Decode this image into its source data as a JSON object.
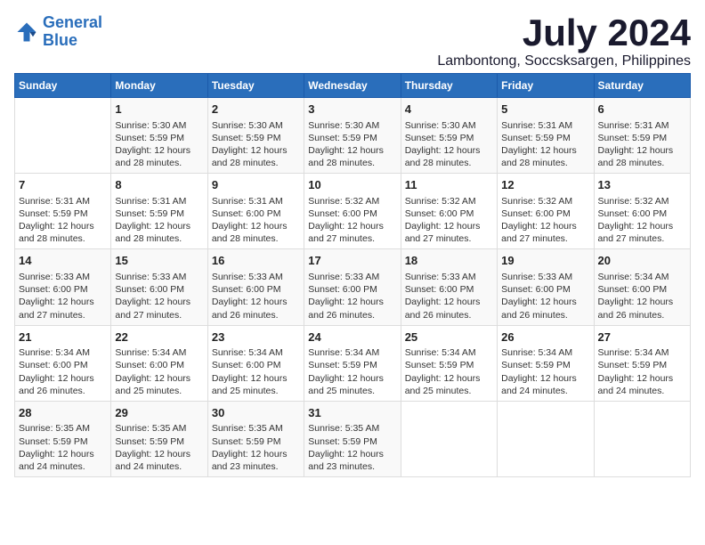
{
  "header": {
    "logo_line1": "General",
    "logo_line2": "Blue",
    "title": "July 2024",
    "subtitle": "Lambontong, Soccsksargen, Philippines"
  },
  "calendar": {
    "days_of_week": [
      "Sunday",
      "Monday",
      "Tuesday",
      "Wednesday",
      "Thursday",
      "Friday",
      "Saturday"
    ],
    "weeks": [
      [
        {
          "day": "",
          "text": ""
        },
        {
          "day": "1",
          "text": "Sunrise: 5:30 AM\nSunset: 5:59 PM\nDaylight: 12 hours\nand 28 minutes."
        },
        {
          "day": "2",
          "text": "Sunrise: 5:30 AM\nSunset: 5:59 PM\nDaylight: 12 hours\nand 28 minutes."
        },
        {
          "day": "3",
          "text": "Sunrise: 5:30 AM\nSunset: 5:59 PM\nDaylight: 12 hours\nand 28 minutes."
        },
        {
          "day": "4",
          "text": "Sunrise: 5:30 AM\nSunset: 5:59 PM\nDaylight: 12 hours\nand 28 minutes."
        },
        {
          "day": "5",
          "text": "Sunrise: 5:31 AM\nSunset: 5:59 PM\nDaylight: 12 hours\nand 28 minutes."
        },
        {
          "day": "6",
          "text": "Sunrise: 5:31 AM\nSunset: 5:59 PM\nDaylight: 12 hours\nand 28 minutes."
        }
      ],
      [
        {
          "day": "7",
          "text": "Sunrise: 5:31 AM\nSunset: 5:59 PM\nDaylight: 12 hours\nand 28 minutes."
        },
        {
          "day": "8",
          "text": "Sunrise: 5:31 AM\nSunset: 5:59 PM\nDaylight: 12 hours\nand 28 minutes."
        },
        {
          "day": "9",
          "text": "Sunrise: 5:31 AM\nSunset: 6:00 PM\nDaylight: 12 hours\nand 28 minutes."
        },
        {
          "day": "10",
          "text": "Sunrise: 5:32 AM\nSunset: 6:00 PM\nDaylight: 12 hours\nand 27 minutes."
        },
        {
          "day": "11",
          "text": "Sunrise: 5:32 AM\nSunset: 6:00 PM\nDaylight: 12 hours\nand 27 minutes."
        },
        {
          "day": "12",
          "text": "Sunrise: 5:32 AM\nSunset: 6:00 PM\nDaylight: 12 hours\nand 27 minutes."
        },
        {
          "day": "13",
          "text": "Sunrise: 5:32 AM\nSunset: 6:00 PM\nDaylight: 12 hours\nand 27 minutes."
        }
      ],
      [
        {
          "day": "14",
          "text": "Sunrise: 5:33 AM\nSunset: 6:00 PM\nDaylight: 12 hours\nand 27 minutes."
        },
        {
          "day": "15",
          "text": "Sunrise: 5:33 AM\nSunset: 6:00 PM\nDaylight: 12 hours\nand 27 minutes."
        },
        {
          "day": "16",
          "text": "Sunrise: 5:33 AM\nSunset: 6:00 PM\nDaylight: 12 hours\nand 26 minutes."
        },
        {
          "day": "17",
          "text": "Sunrise: 5:33 AM\nSunset: 6:00 PM\nDaylight: 12 hours\nand 26 minutes."
        },
        {
          "day": "18",
          "text": "Sunrise: 5:33 AM\nSunset: 6:00 PM\nDaylight: 12 hours\nand 26 minutes."
        },
        {
          "day": "19",
          "text": "Sunrise: 5:33 AM\nSunset: 6:00 PM\nDaylight: 12 hours\nand 26 minutes."
        },
        {
          "day": "20",
          "text": "Sunrise: 5:34 AM\nSunset: 6:00 PM\nDaylight: 12 hours\nand 26 minutes."
        }
      ],
      [
        {
          "day": "21",
          "text": "Sunrise: 5:34 AM\nSunset: 6:00 PM\nDaylight: 12 hours\nand 26 minutes."
        },
        {
          "day": "22",
          "text": "Sunrise: 5:34 AM\nSunset: 6:00 PM\nDaylight: 12 hours\nand 25 minutes."
        },
        {
          "day": "23",
          "text": "Sunrise: 5:34 AM\nSunset: 6:00 PM\nDaylight: 12 hours\nand 25 minutes."
        },
        {
          "day": "24",
          "text": "Sunrise: 5:34 AM\nSunset: 5:59 PM\nDaylight: 12 hours\nand 25 minutes."
        },
        {
          "day": "25",
          "text": "Sunrise: 5:34 AM\nSunset: 5:59 PM\nDaylight: 12 hours\nand 25 minutes."
        },
        {
          "day": "26",
          "text": "Sunrise: 5:34 AM\nSunset: 5:59 PM\nDaylight: 12 hours\nand 24 minutes."
        },
        {
          "day": "27",
          "text": "Sunrise: 5:34 AM\nSunset: 5:59 PM\nDaylight: 12 hours\nand 24 minutes."
        }
      ],
      [
        {
          "day": "28",
          "text": "Sunrise: 5:35 AM\nSunset: 5:59 PM\nDaylight: 12 hours\nand 24 minutes."
        },
        {
          "day": "29",
          "text": "Sunrise: 5:35 AM\nSunset: 5:59 PM\nDaylight: 12 hours\nand 24 minutes."
        },
        {
          "day": "30",
          "text": "Sunrise: 5:35 AM\nSunset: 5:59 PM\nDaylight: 12 hours\nand 23 minutes."
        },
        {
          "day": "31",
          "text": "Sunrise: 5:35 AM\nSunset: 5:59 PM\nDaylight: 12 hours\nand 23 minutes."
        },
        {
          "day": "",
          "text": ""
        },
        {
          "day": "",
          "text": ""
        },
        {
          "day": "",
          "text": ""
        }
      ]
    ]
  }
}
